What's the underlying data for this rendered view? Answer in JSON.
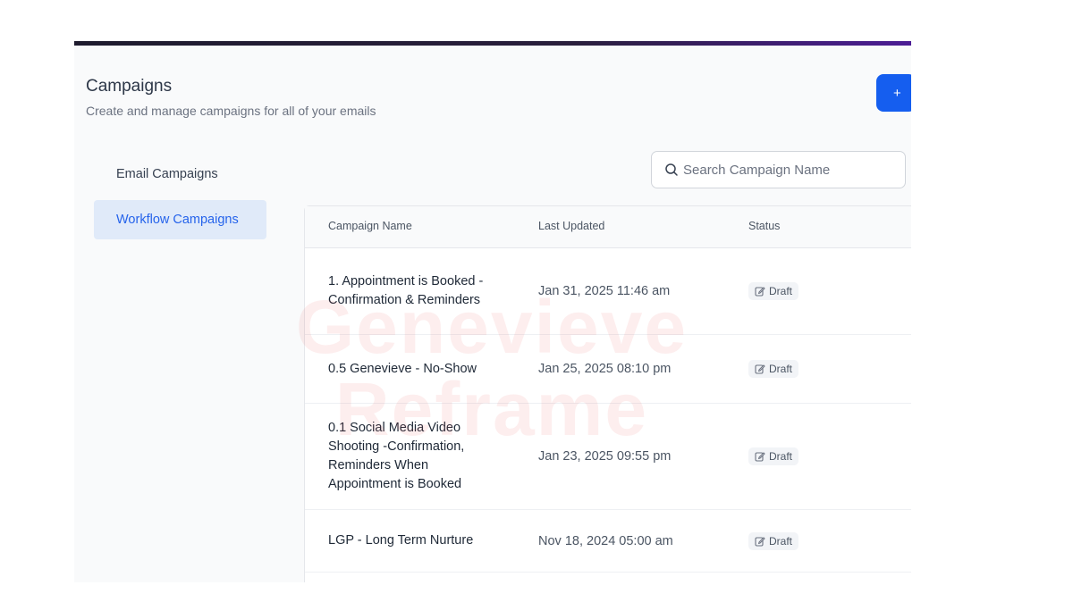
{
  "header": {
    "title": "Campaigns",
    "subtitle": "Create and manage campaigns for all of your emails",
    "add_button_label": "+"
  },
  "nav": {
    "items": [
      {
        "label": "Email Campaigns",
        "active": false
      },
      {
        "label": "Workflow Campaigns",
        "active": true
      }
    ]
  },
  "search": {
    "placeholder": "Search Campaign Name",
    "value": ""
  },
  "table": {
    "columns": [
      "Campaign Name",
      "Last Updated",
      "Status"
    ],
    "rows": [
      {
        "name": "1. Appointment is Booked - Confirmation & Reminders",
        "updated": "Jan 31, 2025 11:46 am",
        "status": "Draft"
      },
      {
        "name": "0.5 Genevieve - No-Show",
        "updated": "Jan 25, 2025 08:10 pm",
        "status": "Draft"
      },
      {
        "name": "0.1 Social Media Video Shooting -Confirmation, Reminders When Appointment is Booked",
        "updated": "Jan 23, 2025 09:55 pm",
        "status": "Draft"
      },
      {
        "name": "LGP - Long Term Nurture",
        "updated": "Nov 18, 2024 05:00 am",
        "status": "Draft"
      }
    ]
  },
  "watermark": {
    "line1": "Genevieve",
    "line2": "Reframe"
  },
  "colors": {
    "accent": "#155eef",
    "active_nav_bg": "#e0eaf9",
    "active_nav_text": "#2563eb",
    "topbar": "#2a1f3d"
  }
}
